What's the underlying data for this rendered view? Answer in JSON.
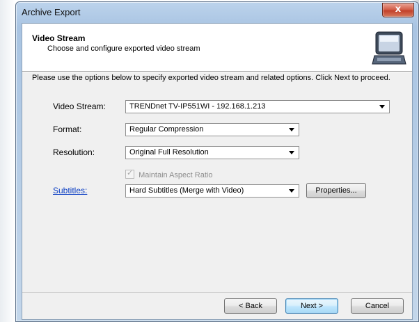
{
  "window": {
    "title": "Archive Export",
    "close_glyph": "x"
  },
  "header": {
    "title": "Video Stream",
    "subtitle": "Choose and configure exported video stream",
    "icon": "computer-monitor-icon"
  },
  "intro_text": "Please use the options below to specify exported video stream and related options. Click Next to proceed.",
  "fields": {
    "video_stream": {
      "label": "Video Stream:",
      "value": "TRENDnet TV-IP551WI - 192.168.1.213"
    },
    "format": {
      "label": "Format:",
      "value": "Regular Compression"
    },
    "resolution": {
      "label": "Resolution:",
      "value": "Original Full Resolution"
    },
    "maintain_aspect": {
      "label": "Maintain Aspect Ratio",
      "checked": true,
      "enabled": false
    },
    "subtitles": {
      "label": "Subtitles:",
      "value": "Hard Subtitles (Merge with Video)",
      "properties_label": "Properties..."
    }
  },
  "buttons": {
    "back": "< Back",
    "next": "Next >",
    "cancel": "Cancel"
  },
  "colors": {
    "link": "#0b3ec3",
    "close_button": "#c2402a",
    "default_button_border": "#3c7fb1"
  }
}
